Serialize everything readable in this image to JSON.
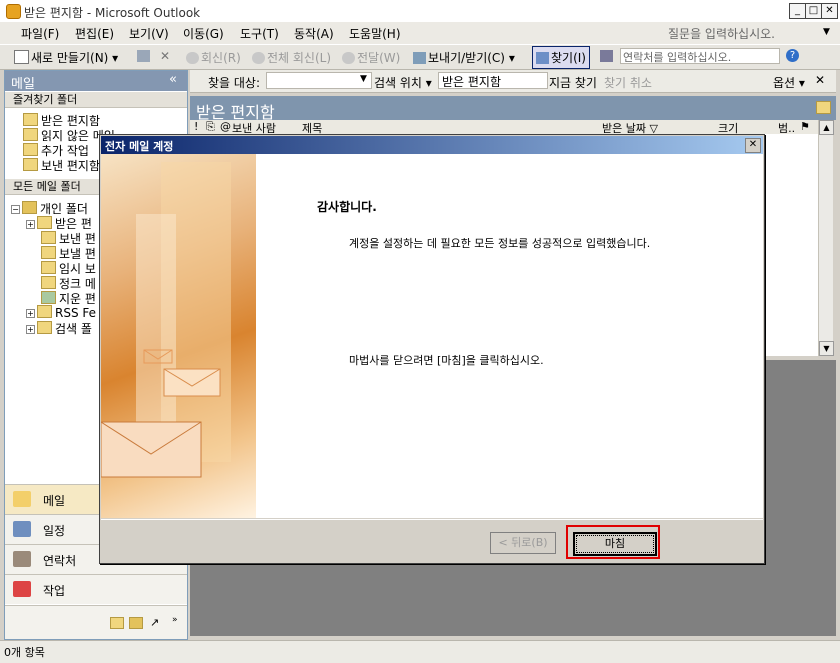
{
  "window": {
    "title": "받은 편지함 - Microsoft Outlook"
  },
  "menu": [
    "파일(F)",
    "편집(E)",
    "보기(V)",
    "이동(G)",
    "도구(T)",
    "동작(A)",
    "도움말(H)"
  ],
  "help_placeholder": "질문을 입력하십시오.",
  "toolbar": {
    "new": "새로 만들기(N)",
    "reply": "회신(R)",
    "reply_all": "전체 회신(L)",
    "forward": "전달(W)",
    "send_receive": "보내기/받기(C)",
    "find": "찾기(I)",
    "contact_placeholder": "연락처를 입력하십시오."
  },
  "nav": {
    "header": "메일",
    "favorites_header": "즐겨찾기 폴더",
    "favorites": [
      "받은 편지함",
      "읽지 않은 메일",
      "추가 작업",
      "보낸 편지함"
    ],
    "all_mail_header": "모든 메일 폴더",
    "tree_root": "개인 폴더",
    "tree_items": [
      "받은 편",
      "보낸 편",
      "보낼 편",
      "임시 보",
      "정크 메",
      "지운 편",
      "RSS Fe",
      "검색 폴"
    ],
    "buttons": [
      "메일",
      "일정",
      "연락처",
      "작업"
    ]
  },
  "findbar": {
    "search_label": "찾을 대상:",
    "search_scope_label": "검색 위치",
    "search_scope_value": "받은 편지함",
    "find_now": "지금 찾기",
    "clear": "찾기 취소",
    "options": "옵션"
  },
  "inbox": {
    "title": "받은 편지함",
    "columns": [
      "보낸 사람",
      "제목",
      "받은 날짜",
      "크기",
      "범.."
    ]
  },
  "dialog": {
    "title": "전자 메일 계정",
    "heading": "감사합니다.",
    "message": "계정을 설정하는 데 필요한 모든 정보를 성공적으로 입력했습니다.",
    "instruction": "마법사를 닫으려면 [마침]을 클릭하십시오.",
    "back_button": "< 뒤로(B)",
    "finish_button": "마침"
  },
  "status": {
    "items": "0개 항목"
  },
  "colors": {
    "nav_header": "#8497b1",
    "dialog_title": "#0a246a",
    "highlight": "#e00000"
  }
}
